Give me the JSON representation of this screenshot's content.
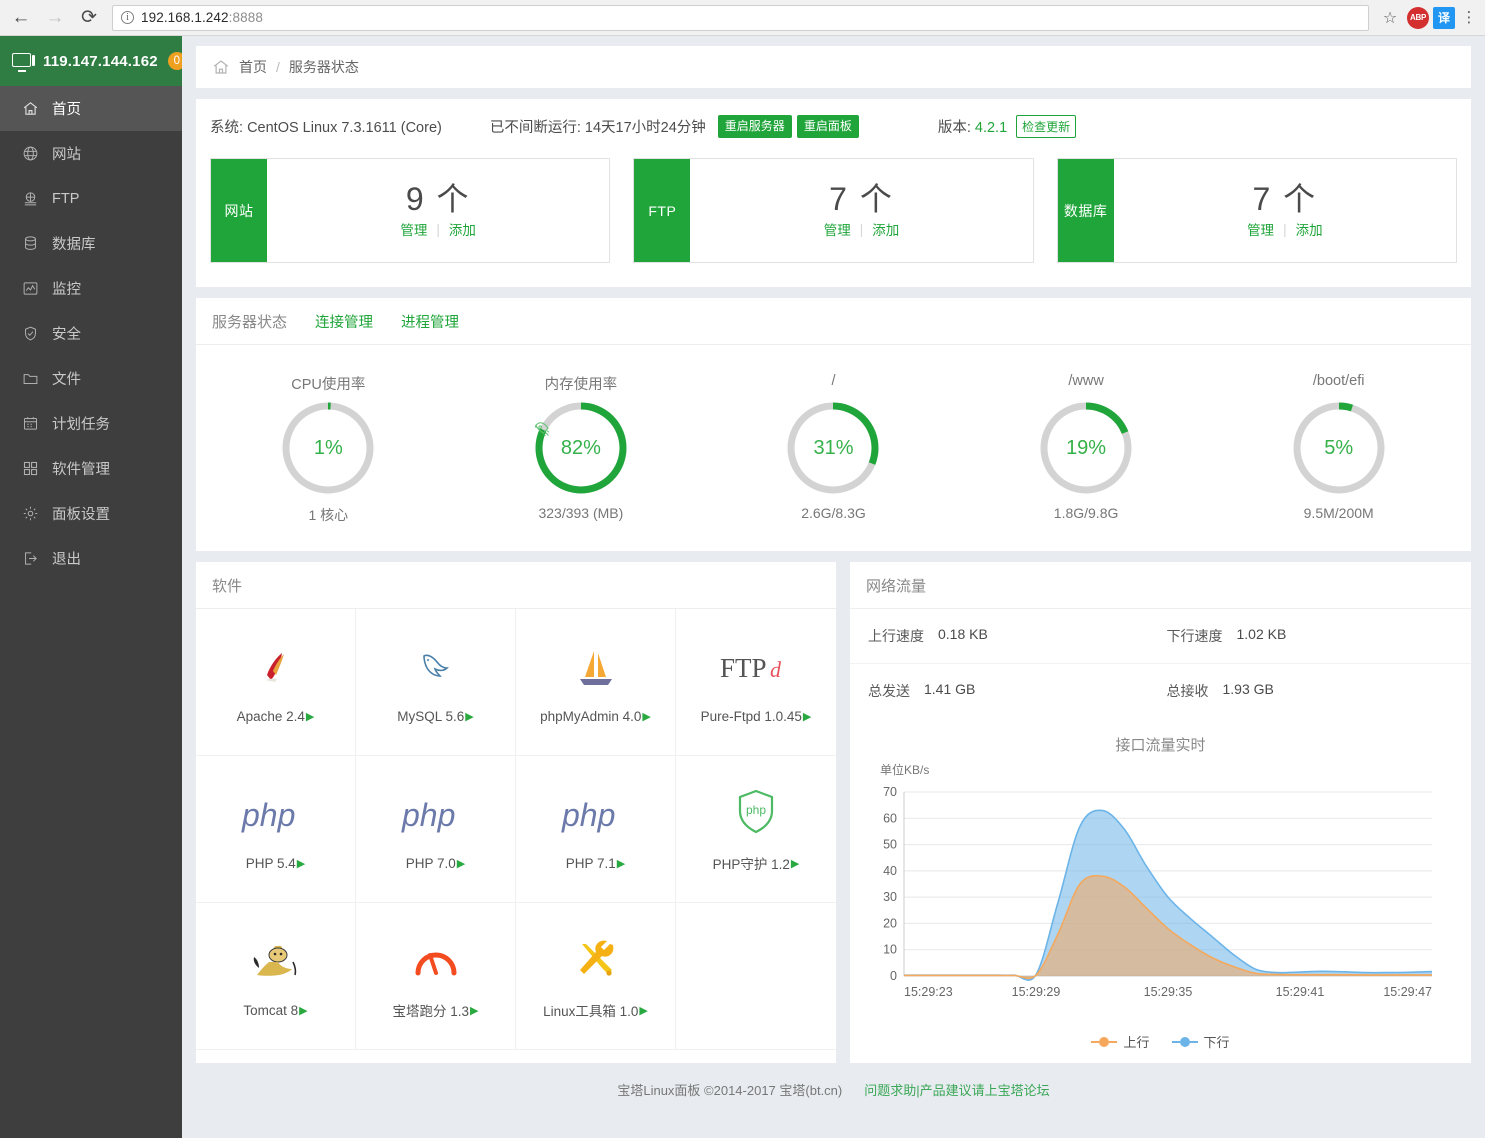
{
  "browser": {
    "back_icon": "←",
    "forward_icon": "→",
    "reload_icon": "⟳",
    "url_main": "192.168.1.242",
    "url_port": ":8888",
    "star_icon": "☆",
    "ext_abp": "ABP",
    "ext_translate": "译",
    "ext_menu": "⋮"
  },
  "sidebar": {
    "ip": "119.147.144.162",
    "badge": "0",
    "items": [
      {
        "label": "首页",
        "icon": "home-icon",
        "active": true
      },
      {
        "label": "网站",
        "icon": "globe-icon",
        "active": false
      },
      {
        "label": "FTP",
        "icon": "ftp-icon",
        "active": false
      },
      {
        "label": "数据库",
        "icon": "database-icon",
        "active": false
      },
      {
        "label": "监控",
        "icon": "monitor-chart-icon",
        "active": false
      },
      {
        "label": "安全",
        "icon": "shield-icon",
        "active": false
      },
      {
        "label": "文件",
        "icon": "folder-icon",
        "active": false
      },
      {
        "label": "计划任务",
        "icon": "calendar-icon",
        "active": false
      },
      {
        "label": "软件管理",
        "icon": "grid-icon",
        "active": false
      },
      {
        "label": "面板设置",
        "icon": "gear-icon",
        "active": false
      },
      {
        "label": "退出",
        "icon": "logout-icon",
        "active": false
      }
    ]
  },
  "breadcrumb": {
    "home": "首页",
    "separator": "/",
    "current": "服务器状态"
  },
  "system": {
    "os_label": "系统:",
    "os_value": "CentOS Linux 7.3.1611 (Core)",
    "uptime_label": "已不间断运行:",
    "uptime_value": "14天17小时24分钟",
    "restart_server": "重启服务器",
    "restart_panel": "重启面板",
    "version_label": "版本:",
    "version_value": "4.2.1",
    "check_update": "检查更新"
  },
  "cards": [
    {
      "tag": "网站",
      "count": "9 个",
      "manage": "管理",
      "add": "添加"
    },
    {
      "tag": "FTP",
      "count": "7 个",
      "manage": "管理",
      "add": "添加"
    },
    {
      "tag": "数据库",
      "count": "7 个",
      "manage": "管理",
      "add": "添加"
    }
  ],
  "status": {
    "title": "服务器状态",
    "link_connection": "连接管理",
    "link_process": "进程管理",
    "gauges": [
      {
        "title": "CPU使用率",
        "percent": 1,
        "value": "1%",
        "sub": "1 核心",
        "rocket": false
      },
      {
        "title": "内存使用率",
        "percent": 82,
        "value": "82%",
        "sub": "323/393 (MB)",
        "rocket": true
      },
      {
        "title": "/",
        "percent": 31,
        "value": "31%",
        "sub": "2.6G/8.3G",
        "rocket": false
      },
      {
        "title": "/www",
        "percent": 19,
        "value": "19%",
        "sub": "1.8G/9.8G",
        "rocket": false
      },
      {
        "title": "/boot/efi",
        "percent": 5,
        "value": "5%",
        "sub": "9.5M/200M",
        "rocket": false
      }
    ]
  },
  "software": {
    "title": "软件",
    "items": [
      {
        "name": "Apache 2.4",
        "icon": "apache-feather-icon"
      },
      {
        "name": "MySQL 5.6",
        "icon": "mysql-dolphin-icon"
      },
      {
        "name": "phpMyAdmin 4.0",
        "icon": "phpmyadmin-sailboat-icon"
      },
      {
        "name": "Pure-Ftpd 1.0.45",
        "icon": "pureftpd-icon"
      },
      {
        "name": "PHP 5.4",
        "icon": "php-icon"
      },
      {
        "name": "PHP 7.0",
        "icon": "php-icon"
      },
      {
        "name": "PHP 7.1",
        "icon": "php-icon"
      },
      {
        "name": "PHP守护 1.2",
        "icon": "php-shield-icon"
      },
      {
        "name": "Tomcat 8",
        "icon": "tomcat-cat-icon"
      },
      {
        "name": "宝塔跑分 1.3",
        "icon": "speedometer-icon"
      },
      {
        "name": "Linux工具箱 1.0",
        "icon": "tools-icon"
      }
    ],
    "play_glyph": "▶"
  },
  "network": {
    "title": "网络流量",
    "up_speed_label": "上行速度",
    "up_speed_value": "0.18 KB",
    "down_speed_label": "下行速度",
    "down_speed_value": "1.02 KB",
    "total_sent_label": "总发送",
    "total_sent_value": "1.41 GB",
    "total_recv_label": "总接收",
    "total_recv_value": "1.93 GB"
  },
  "chart_data": {
    "type": "area",
    "title": "接口流量实时",
    "ylabel": "单位KB/s",
    "xlabel": "",
    "ylim": [
      0,
      70
    ],
    "yticks": [
      0,
      10,
      20,
      30,
      40,
      50,
      60,
      70
    ],
    "xticks": [
      "15:29:23",
      "15:29:29",
      "15:29:35",
      "15:29:41",
      "15:29:47"
    ],
    "grid": true,
    "legend_position": "bottom",
    "x": [
      "15:29:23",
      "15:29:24",
      "15:29:25",
      "15:29:26",
      "15:29:27",
      "15:29:28",
      "15:29:29",
      "15:29:30",
      "15:29:31",
      "15:29:32",
      "15:29:33",
      "15:29:34",
      "15:29:35",
      "15:29:36",
      "15:29:37",
      "15:29:38",
      "15:29:39",
      "15:29:40",
      "15:29:41",
      "15:29:42",
      "15:29:43",
      "15:29:44",
      "15:29:45",
      "15:29:46",
      "15:29:47"
    ],
    "series": [
      {
        "name": "上行",
        "color": "#f5a85c",
        "values": [
          0.2,
          0.2,
          0.2,
          0.2,
          0.2,
          0.2,
          0.3,
          16,
          35,
          38,
          34,
          26,
          18,
          12,
          7,
          3.5,
          1.0,
          0.6,
          0.5,
          0.5,
          0.5,
          0.4,
          0.4,
          0.4,
          0.4
        ]
      },
      {
        "name": "下行",
        "color": "#6cb4e8",
        "values": [
          0.3,
          0.3,
          0.3,
          0.3,
          0.3,
          0.3,
          0.5,
          28,
          57,
          63,
          56,
          42,
          30,
          22,
          15,
          8,
          2.5,
          1.3,
          1.5,
          1.8,
          1.6,
          1.3,
          1.3,
          1.4,
          1.7
        ]
      }
    ]
  },
  "footer": {
    "copyright": "宝塔Linux面板 ©2014-2017 宝塔(bt.cn)",
    "link": "问题求助|产品建议请上宝塔论坛"
  },
  "colors": {
    "green": "#20a53a",
    "green_dark": "#2f7d43",
    "orange": "#f0a020",
    "up": "#f5a85c",
    "down": "#6cb4e8"
  }
}
